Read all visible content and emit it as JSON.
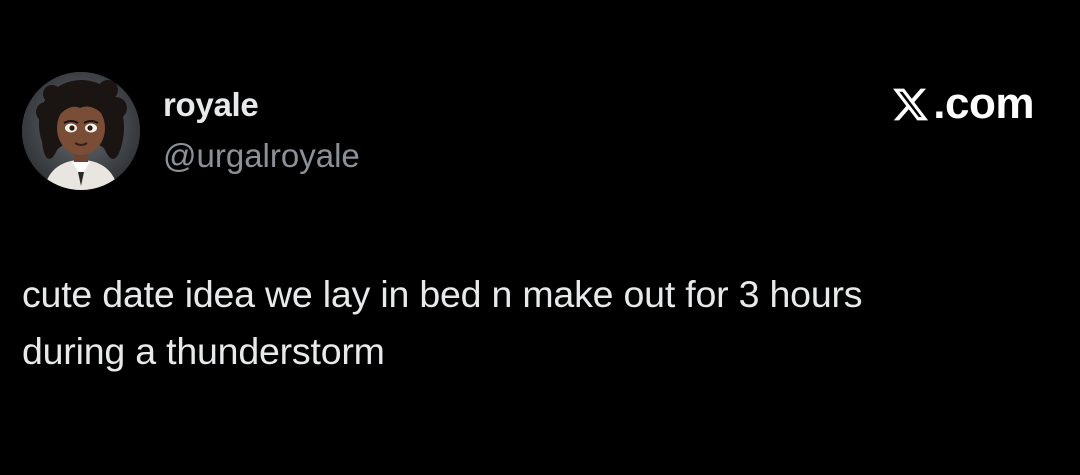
{
  "tweet": {
    "author": {
      "display_name": "royale",
      "handle": "@urgalroyale",
      "avatar_icon": "cartoon-girl-avatar"
    },
    "source": {
      "logo_icon": "x-logo-icon",
      "domain": ".com"
    },
    "text_lines": [
      "cute date idea we lay in bed n make out for 3 hours",
      "during a thunderstorm"
    ]
  },
  "colors": {
    "background": "#000000",
    "primary_text": "#e7e9ea",
    "secondary_text": "#8b9196",
    "logo": "#ffffff"
  }
}
